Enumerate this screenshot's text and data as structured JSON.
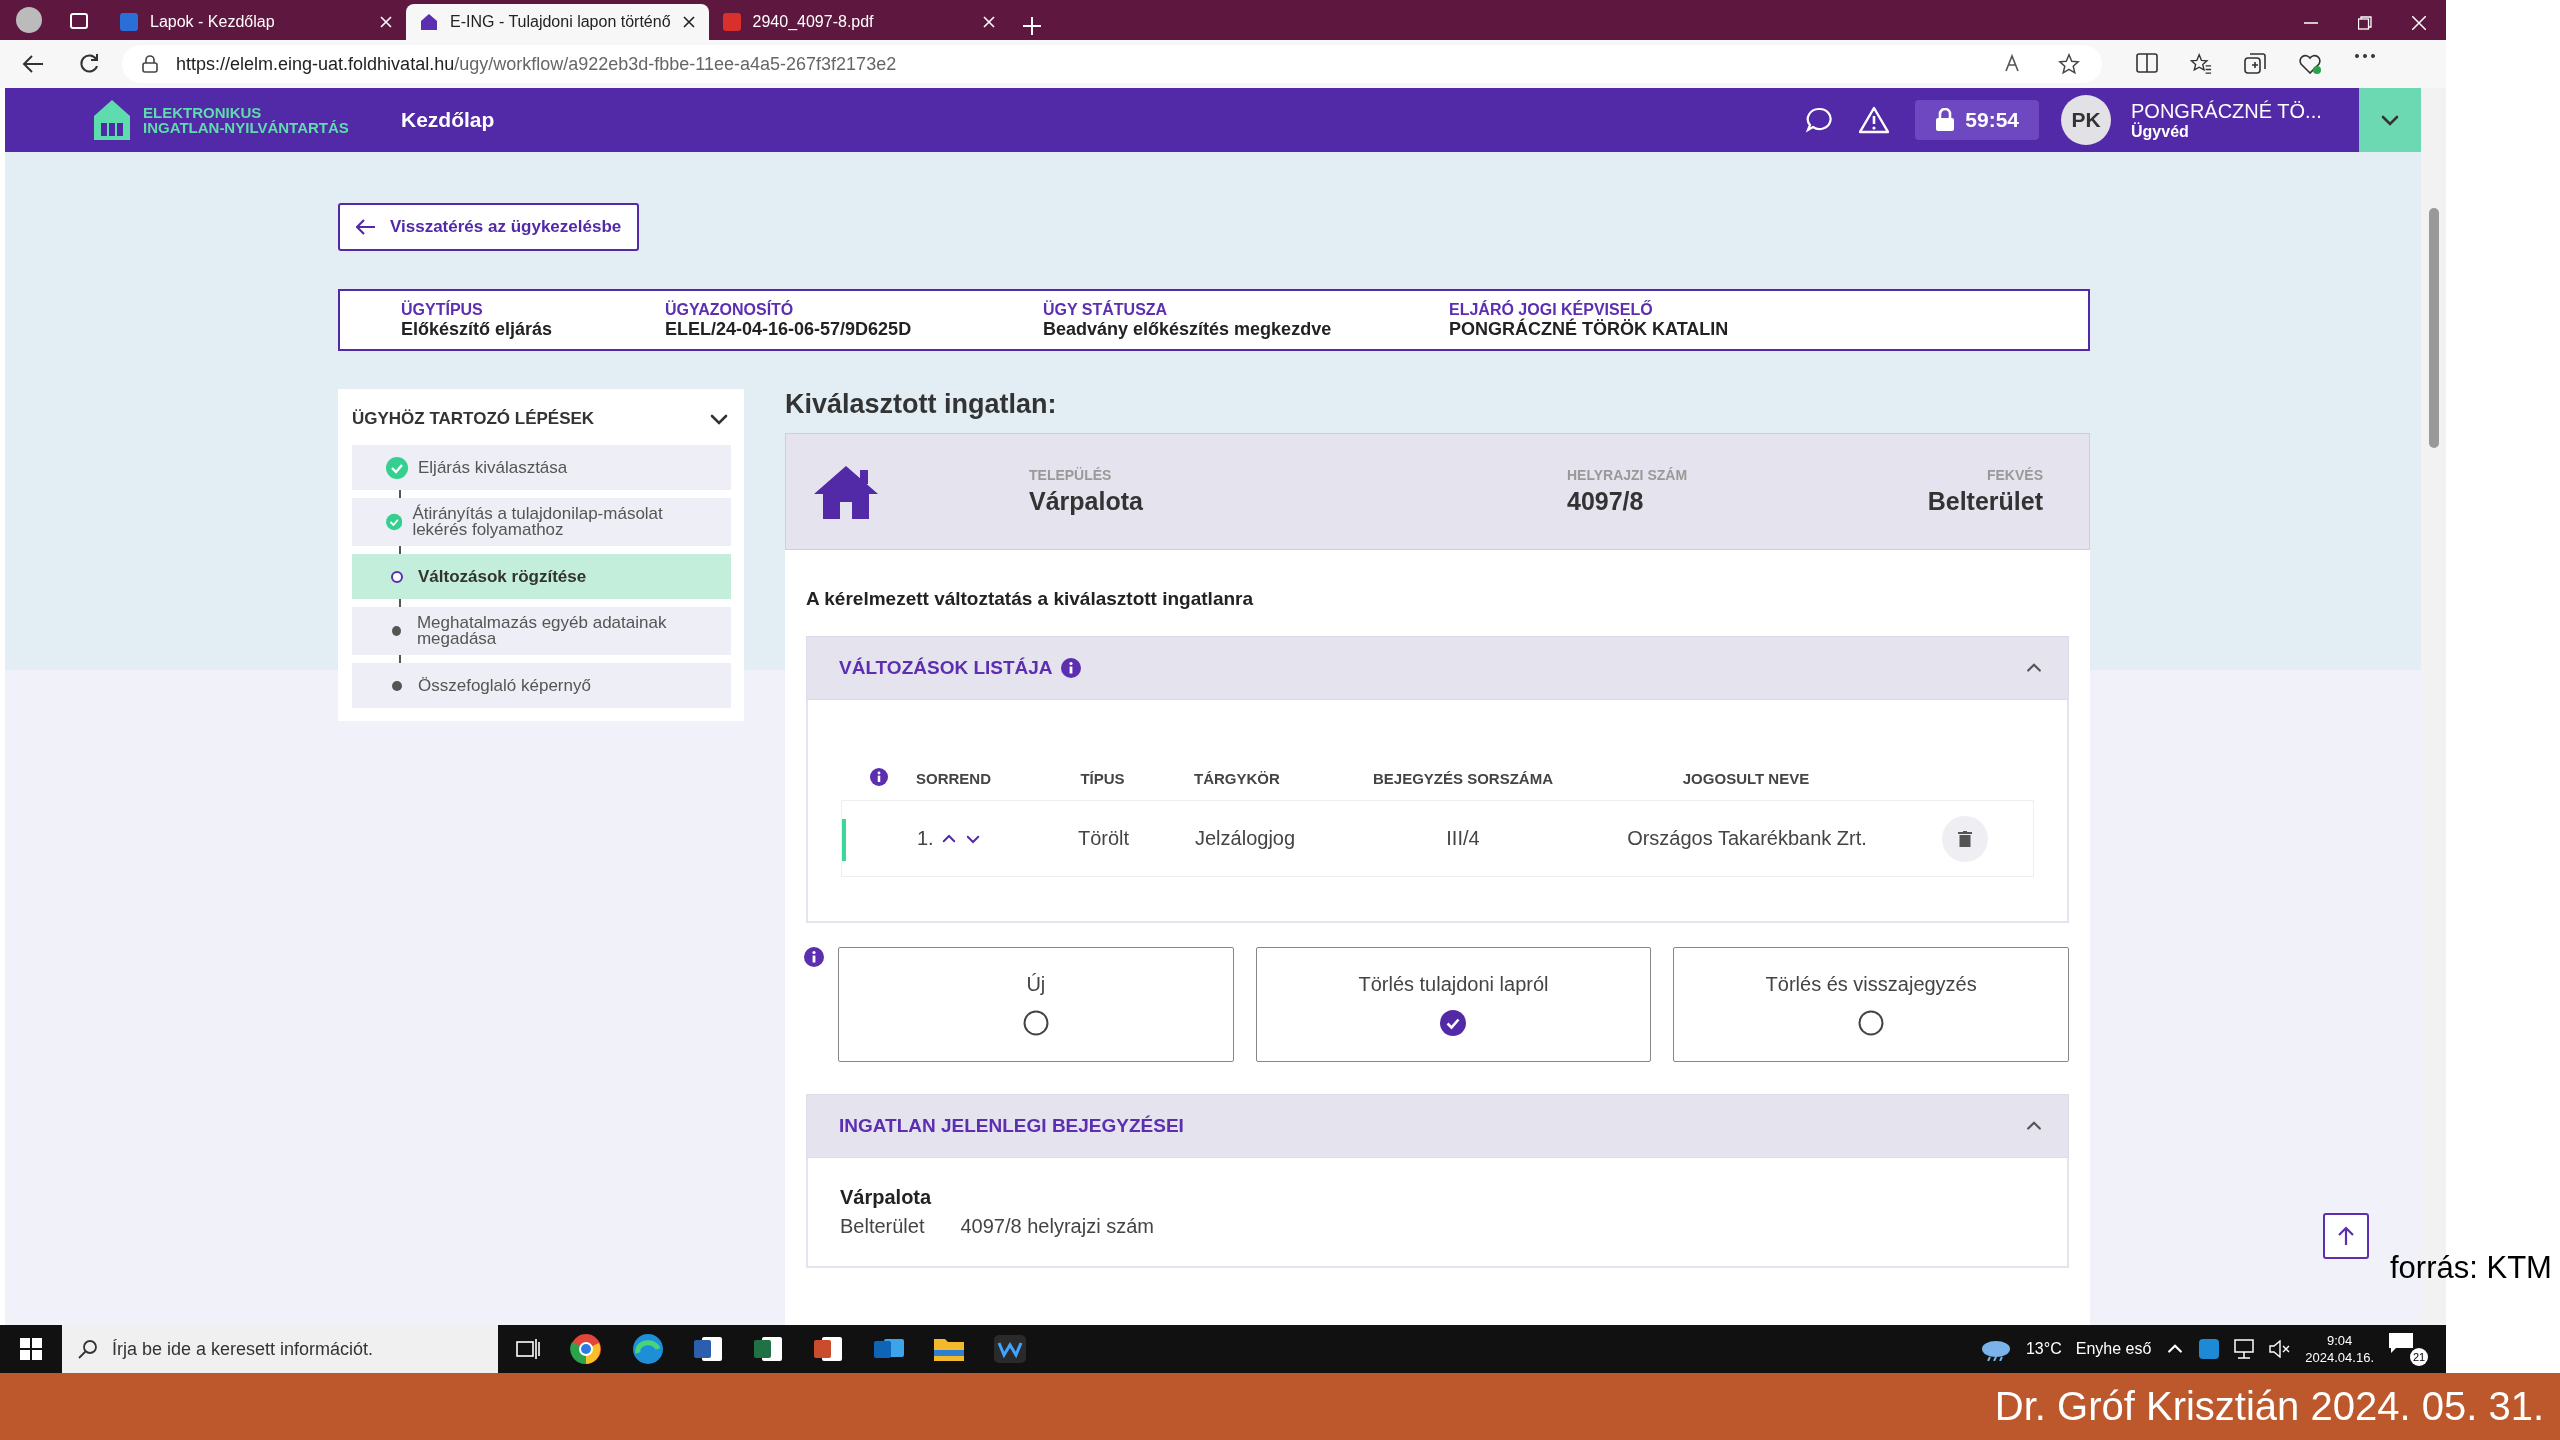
{
  "browser": {
    "tabs": [
      {
        "title": "Lapok - Kezdőlap",
        "kind": "site",
        "selected": false
      },
      {
        "title": "E-ING - Tulajdoni lapon történő",
        "kind": "app",
        "selected": true
      },
      {
        "title": "2940_4097-8.pdf",
        "kind": "pdf",
        "selected": false
      }
    ],
    "url_host": "https://elelm.eing-uat.foldhivatal.hu",
    "url_path": "/ugy/workflow/a922eb3d-fbbe-11ee-a4a5-267f3f2173e2"
  },
  "header": {
    "logo_lines": [
      "ELEKTRONIKUS",
      "INGATLAN-NYILVÁNTARTÁS"
    ],
    "title": "Kezdőlap",
    "timer": "59:54",
    "avatar": "PK",
    "user_name": "PONGRÁCZNÉ TÖ...",
    "user_role": "Ügyvéd"
  },
  "back_button": "Visszatérés az ügykezelésbe",
  "case_info": [
    {
      "label": "ÜGYTÍPUS",
      "value": "Előkészítő eljárás"
    },
    {
      "label": "ÜGYAZONOSÍTÓ",
      "value": "ELEL/24-04-16-06-57/9D625D"
    },
    {
      "label": "ÜGY STÁTUSZA",
      "value": "Beadvány előkészítés megkezdve"
    },
    {
      "label": "ELJÁRÓ JOGI KÉPVISELŐ",
      "value": "PONGRÁCZNÉ TÖRÖK KATALIN"
    }
  ],
  "steps": {
    "title": "ÜGYHÖZ TARTOZÓ LÉPÉSEK",
    "items": [
      {
        "label": "Eljárás kiválasztása",
        "kind": "done",
        "selected": false
      },
      {
        "label": "Átirányítás a tulajdonilap-másolat lekérés folyamathoz",
        "kind": "done",
        "selected": false
      },
      {
        "label": "Változások rögzítése",
        "kind": "current",
        "selected": true
      },
      {
        "label": "Meghatalmazás egyéb adatainak megadása",
        "kind": "pending",
        "selected": false
      },
      {
        "label": "Összefoglaló képernyő",
        "kind": "pending",
        "selected": false
      }
    ]
  },
  "property": {
    "title": "Kiválasztott ingatlan:",
    "fields": [
      {
        "label": "TELEPÜLÉS",
        "value": "Várpalota"
      },
      {
        "label": "HELYRAJZI SZÁM",
        "value": "4097/8"
      },
      {
        "label": "FEKVÉS",
        "value": "Belterület"
      }
    ]
  },
  "request_title": "A kérelmezett változtatás a kiválasztott ingatlanra",
  "changes": {
    "title": "VÁLTOZÁSOK LISTÁJA",
    "expanded": true,
    "columns": [
      "SORREND",
      "TÍPUS",
      "TÁRGYKÖR",
      "BEJEGYZÉS SORSZÁMA",
      "JOGOSULT NEVE"
    ],
    "rows": [
      {
        "order": "1.",
        "type": "Törölt",
        "subject": "Jelzálogjog",
        "entry_no": "III/4",
        "holder": "Országos Takarékbank Zrt."
      }
    ]
  },
  "options": [
    {
      "label": "Új",
      "selected": false
    },
    {
      "label": "Törlés tulajdoni lapról",
      "selected": true
    },
    {
      "label": "Törlés és visszajegyzés",
      "selected": false
    }
  ],
  "current_entries": {
    "title": "INGATLAN JELENLEGI BEJEGYZÉSEI",
    "expanded": true,
    "place": "Várpalota",
    "area": "Belterület",
    "parcel": "4097/8 helyrajzi szám"
  },
  "taskbar": {
    "search_placeholder": "Írja be ide a keresett információt.",
    "temperature": "13°C",
    "weather": "Enyhe eső",
    "time": "9:04",
    "date": "2024.04.16.",
    "notifications": "21"
  },
  "slide": {
    "source": "forrás: KTM",
    "footer": "Dr. Gróf Krisztián 2024. 05. 31."
  }
}
